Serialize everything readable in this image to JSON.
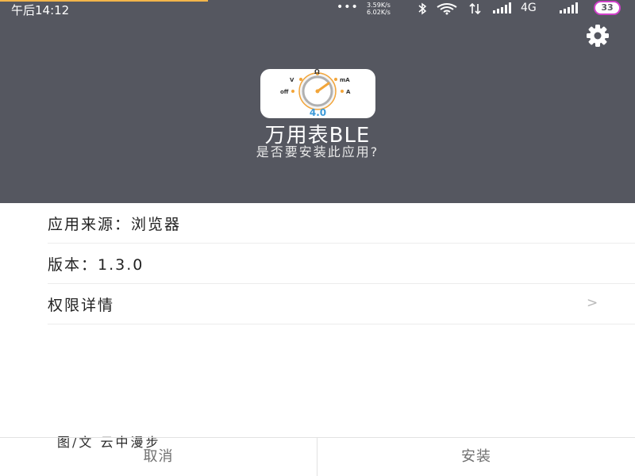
{
  "status_bar": {
    "time": "午后14:12",
    "dots": "•••",
    "upload_speed": "3.59K/s",
    "download_speed": "6.02K/s",
    "network": "4G",
    "battery": "33"
  },
  "app": {
    "icon_version": "4.0",
    "icon_label_v": "V",
    "icon_label_ohm": "Ω",
    "icon_label_ma": "mA",
    "icon_label_off": "off",
    "icon_label_a": "A",
    "name": "万用表BLE",
    "prompt": "是否要安装此应用?"
  },
  "info": {
    "source": "应用来源：浏览器",
    "version": "版本：1.3.0",
    "permissions": "权限详情",
    "chevron": ">"
  },
  "watermark": "图/文  云中漫步",
  "actions": {
    "cancel": "取消",
    "install": "安装"
  },
  "colors": {
    "header_bg": "#555760",
    "accent_progress": "#f3b54a",
    "battery_ring": "#d040c9",
    "icon_version": "#3c9ad9",
    "dial_ring": "#f2a53a"
  }
}
